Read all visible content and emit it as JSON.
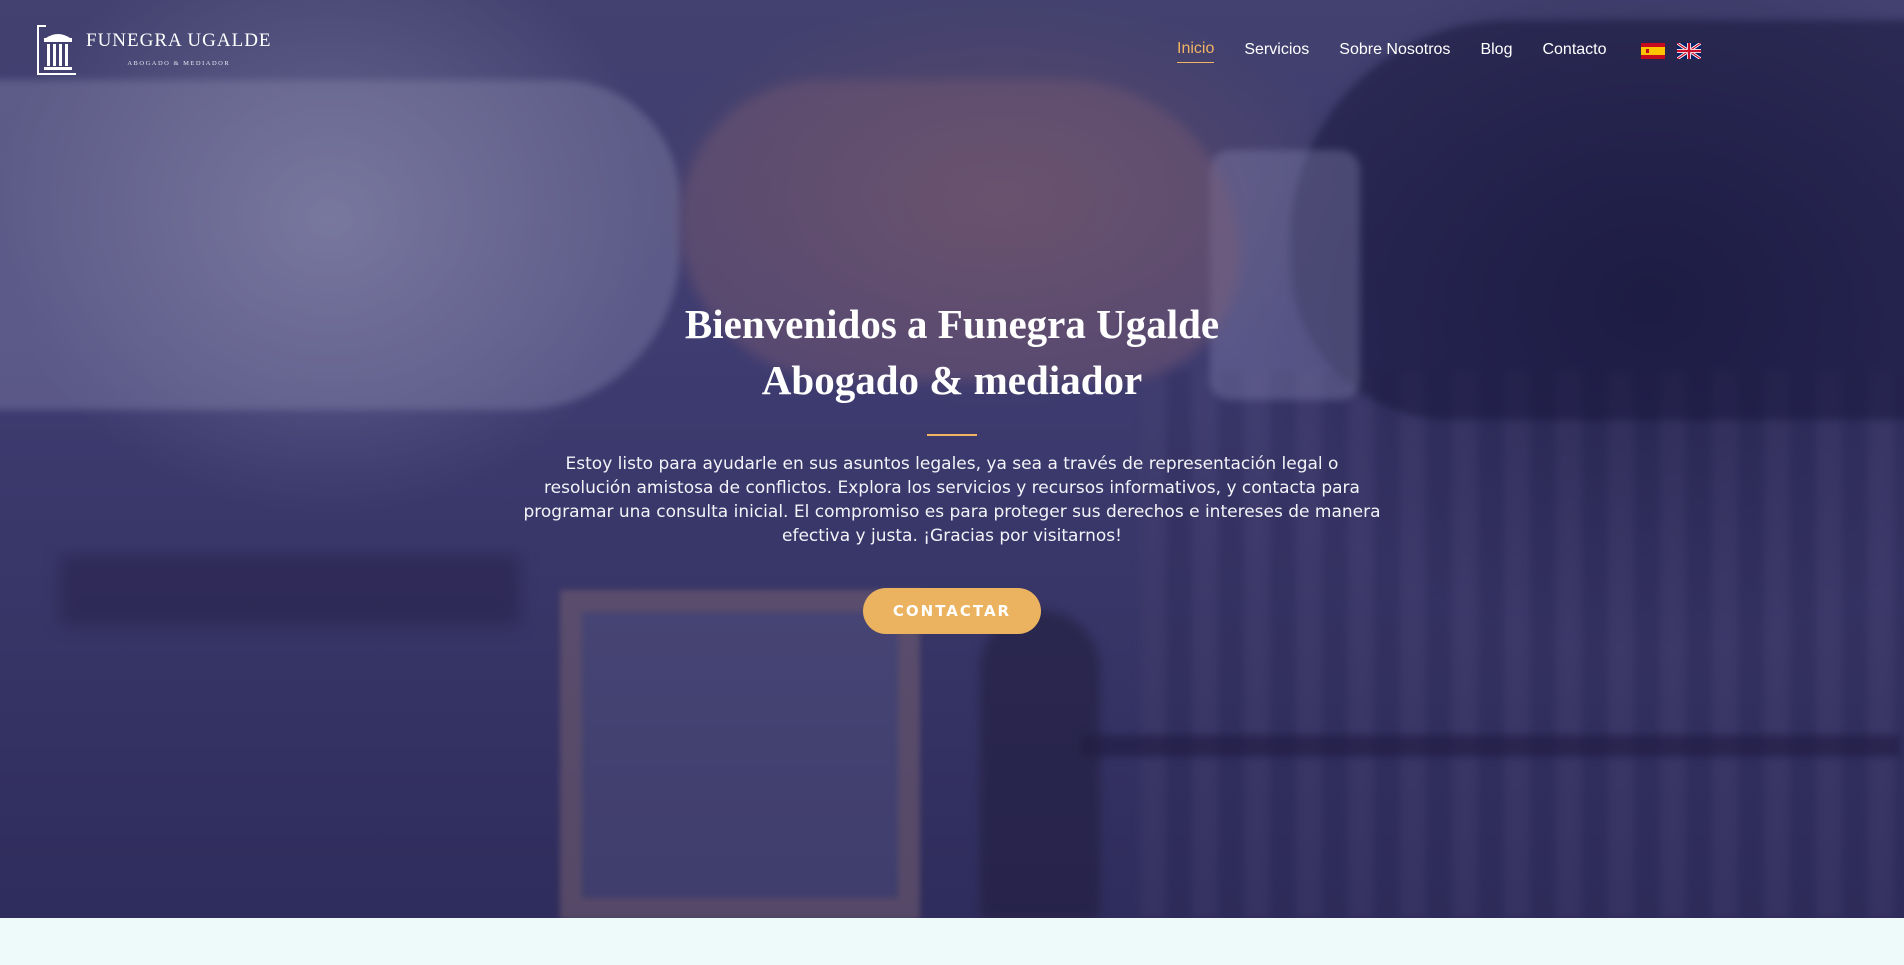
{
  "brand": {
    "name": "FUNEGRA UGALDE",
    "tagline": "ABOGADO & MEDIADOR"
  },
  "nav": {
    "items": [
      {
        "label": "Inicio",
        "active": true
      },
      {
        "label": "Servicios"
      },
      {
        "label": "Sobre Nosotros"
      },
      {
        "label": "Blog"
      },
      {
        "label": "Contacto"
      }
    ]
  },
  "languages": [
    {
      "icon": "spain-flag-icon",
      "code": "es"
    },
    {
      "icon": "uk-flag-icon",
      "code": "en"
    }
  ],
  "hero": {
    "title_line1": "Bienvenidos a Funegra Ugalde",
    "title_line2": "Abogado & mediador",
    "description": "Estoy listo para ayudarle en sus asuntos legales, ya sea a través de representación legal o resolución amistosa de conflictos. Explora los servicios y recursos informativos, y contacta para programar una consulta inicial. El compromiso es para proteger sus derechos e intereses de manera efectiva y justa. ¡Gracias por visitarnos!",
    "cta_label": "CONTACTAR"
  },
  "colors": {
    "accent": "#ebb25f",
    "nav_active": "#f0b462",
    "hero_overlay": "#2d2a5f",
    "page_bg": "#eefafa"
  }
}
